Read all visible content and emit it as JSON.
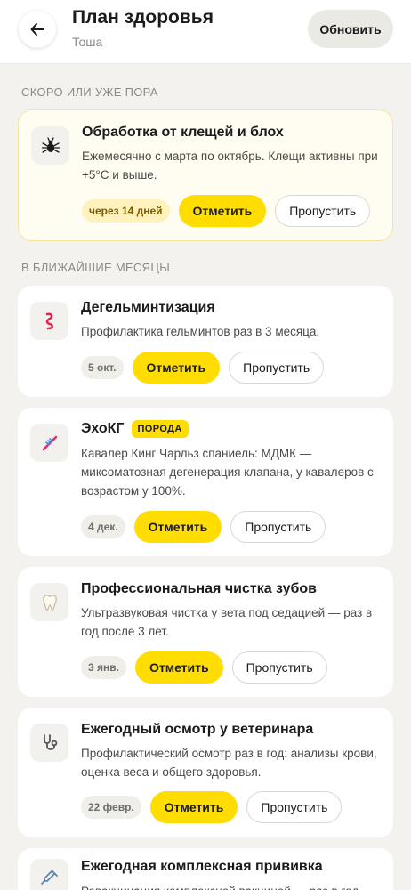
{
  "header": {
    "title": "План здоровья",
    "subtitle": "Тоша",
    "refresh_label": "Обновить",
    "back_icon": "arrow-left-icon"
  },
  "sections": {
    "soon_label": "СКОРО ИЛИ УЖЕ ПОРА",
    "upcoming_label": "В БЛИЖАЙШИЕ МЕСЯЦЫ"
  },
  "actions": {
    "mark_label": "Отметить",
    "skip_label": "Пропустить"
  },
  "soon_items": [
    {
      "icon": "tick-icon",
      "title": "Обработка от клещей и блох",
      "desc": "Ежемесячно с марта по октябрь. Клещи активны при +5°C и выше.",
      "due": "через 14 дней"
    }
  ],
  "upcoming_items": [
    {
      "icon": "worm-icon",
      "title": "Дегельминтизация",
      "desc": "Профилактика гельминтов раз в 3 месяца.",
      "due": "5 окт."
    },
    {
      "icon": "dna-icon",
      "title": "ЭхоКГ",
      "badge": "ПОРОДА",
      "desc": "Кавалер Кинг Чарльз спаниель: МДМК — миксоматозная дегенерация клапана, у кавалеров с возрастом у 100%.",
      "due": "4 дек."
    },
    {
      "icon": "tooth-icon",
      "title": "Профессиональная чистка зубов",
      "desc": "Ультразвуковая чистка у вета под седацией — раз в год после 3 лет.",
      "due": "3 янв."
    },
    {
      "icon": "stethoscope-icon",
      "title": "Ежегодный осмотр у ветеринара",
      "desc": "Профилактический осмотр раз в год: анализы крови, оценка веса и общего здоровья.",
      "due": "22 февр."
    },
    {
      "icon": "syringe-icon",
      "title": "Ежегодная комплексная прививка",
      "desc": "Ревакцинация комплексной вакциной — раз в год."
    }
  ],
  "colors": {
    "accent": "#ffdd00",
    "background": "#f3f2ee",
    "soon_card_bg": "#fffdf2",
    "soon_card_border": "#f4e49c"
  }
}
